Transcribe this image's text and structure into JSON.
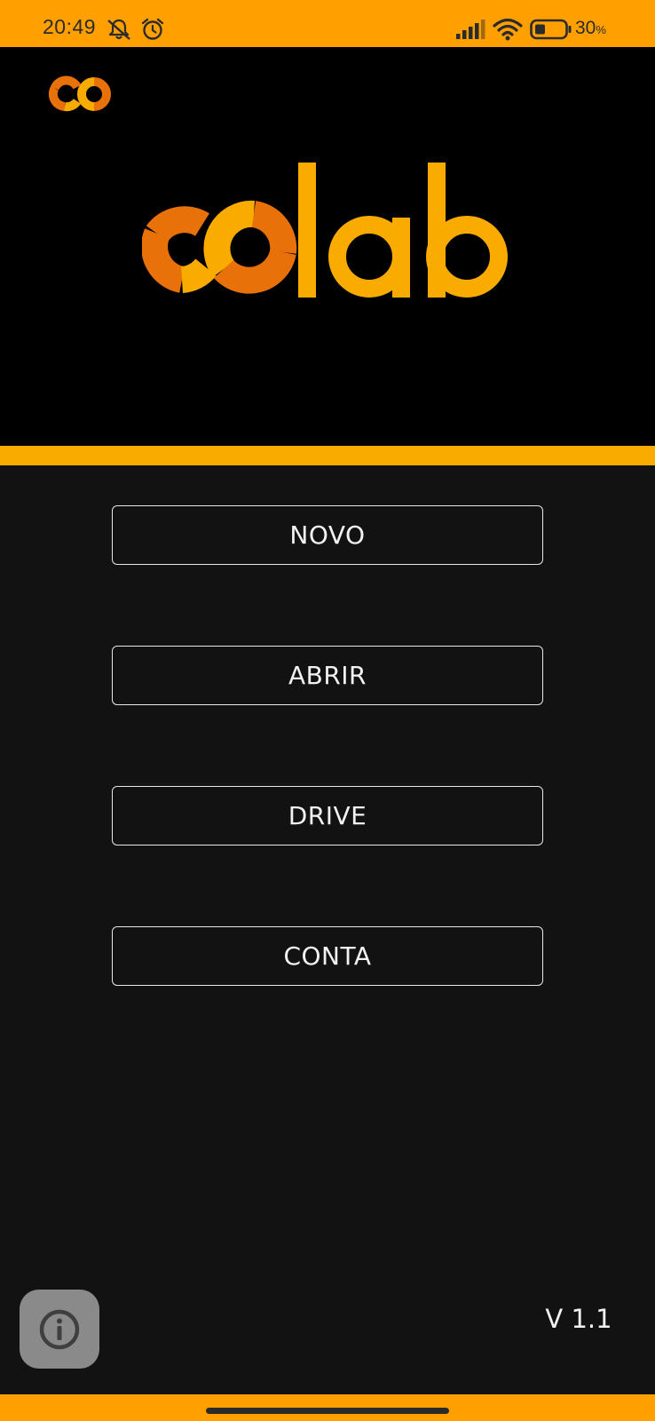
{
  "status_bar": {
    "time": "20:49",
    "battery_percent": "30",
    "battery_unit": "%",
    "icons": [
      "notifications-off-icon",
      "alarm-icon",
      "signal-icon",
      "wifi-icon",
      "battery-icon"
    ],
    "background_color": "#ffa000"
  },
  "header": {
    "small_logo": "CO",
    "brand_logo": "colab",
    "logo_dark_orange": "#e8710a",
    "logo_orange": "#f9ab00"
  },
  "menu": {
    "buttons": [
      {
        "label": "NOVO"
      },
      {
        "label": "ABRIR"
      },
      {
        "label": "DRIVE"
      },
      {
        "label": "CONTA"
      }
    ]
  },
  "footer": {
    "info_icon": "info-icon",
    "version": "V 1.1"
  },
  "theme": {
    "accent": "#ffa000",
    "background": "#121212",
    "header_background": "#000000"
  }
}
